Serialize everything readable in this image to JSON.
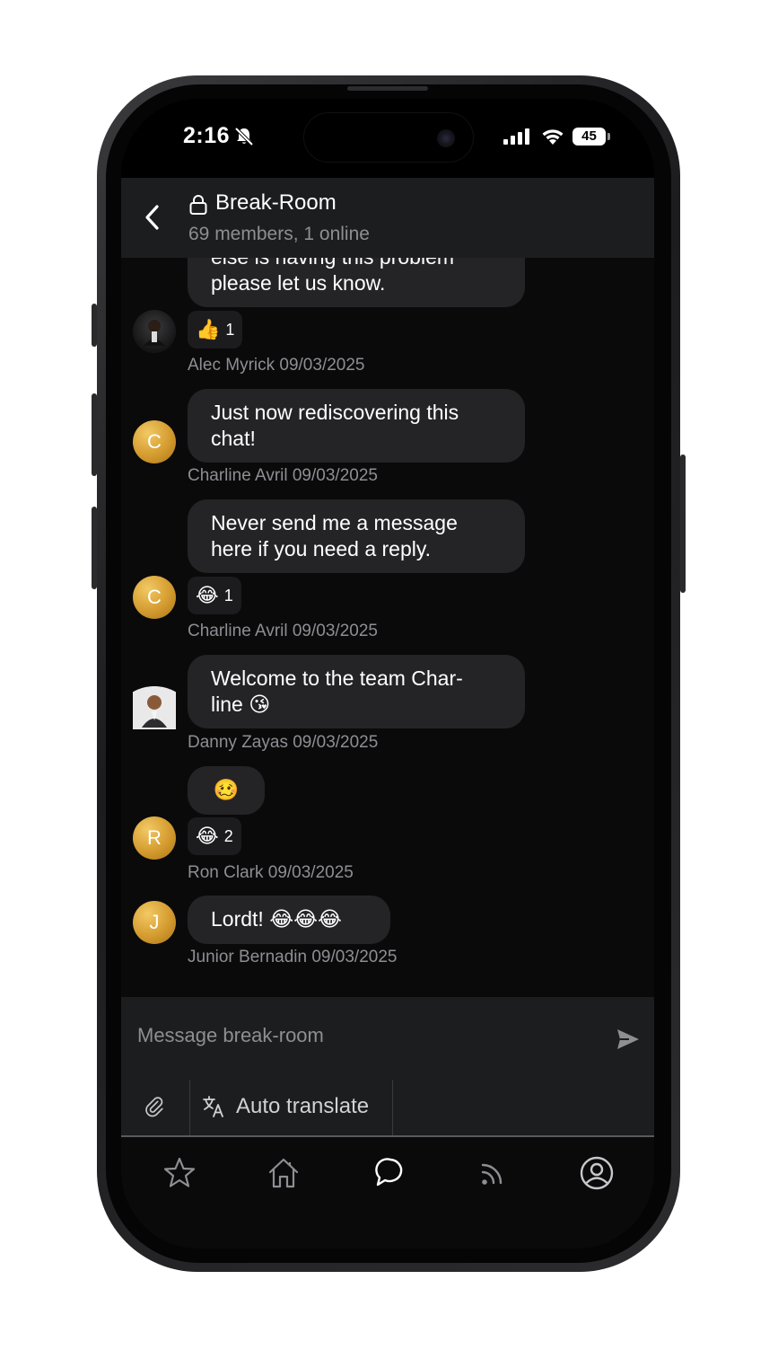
{
  "status_bar": {
    "time": "2:16",
    "battery": "45"
  },
  "header": {
    "title": "Break-Room",
    "subtitle": "69 members, 1 online"
  },
  "messages": [
    {
      "text": "else is having this problem please let us know.",
      "line1": "else is having this problem",
      "line2": "please let us know.",
      "reaction_emoji": "👍",
      "reaction_count": "1",
      "sender": "Alec Myrick",
      "date": "09/03/2025",
      "meta": "Alec Myrick 09/03/2025"
    },
    {
      "line1": "Just now rediscovering this",
      "line2": "chat!",
      "sender": "Charline Avril",
      "date": "09/03/2025",
      "meta": "Charline Avril 09/03/2025",
      "avatar_initial": "C"
    },
    {
      "line1": "Never send me a message",
      "line2": "here if you need a reply.",
      "reaction_emoji": "😂",
      "reaction_count": "1",
      "sender": "Charline Avril",
      "date": "09/03/2025",
      "meta": "Charline Avril 09/03/2025",
      "avatar_initial": "C"
    },
    {
      "line1": "Welcome to the team Char-",
      "line2": "line 😘",
      "sender": "Danny Zayas",
      "date": "09/03/2025",
      "meta": "Danny Zayas 09/03/2025"
    },
    {
      "line1": "🥴",
      "reaction_emoji": "😂",
      "reaction_count": "2",
      "sender": "Ron Clark",
      "date": "09/03/2025",
      "meta": "Ron Clark 09/03/2025",
      "avatar_initial": "R"
    },
    {
      "line1": "Lordt! 😂😂😂",
      "sender": "Junior Bernadin",
      "date": "09/03/2025",
      "meta": "Junior Bernadin 09/03/2025",
      "avatar_initial": "J"
    }
  ],
  "composer": {
    "placeholder": "Message break-room",
    "translate_label": "Auto translate"
  },
  "tabs": [
    {
      "icon": "star-icon"
    },
    {
      "icon": "home-icon"
    },
    {
      "icon": "chat-icon"
    },
    {
      "icon": "feed-icon"
    },
    {
      "icon": "profile-icon"
    }
  ],
  "colors": {
    "background": "#0a0a0b",
    "header": "#1c1d1f",
    "bubble": "#242426",
    "avatar_gold": "#d49b2f",
    "muted_text": "#8e8e93"
  }
}
